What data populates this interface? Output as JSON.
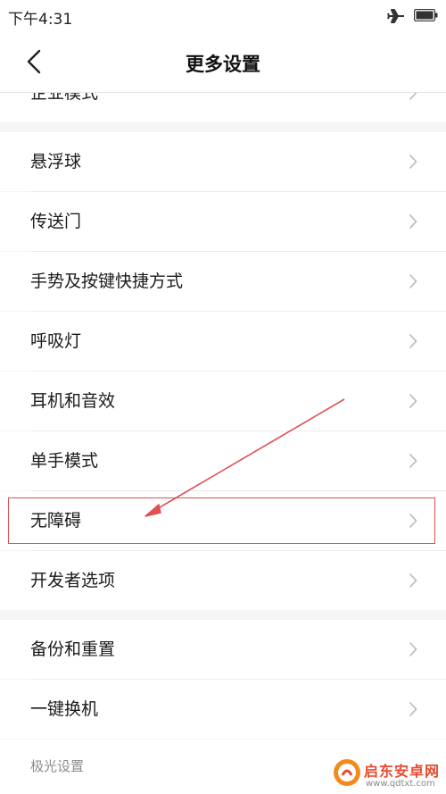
{
  "status_bar": {
    "time": "下午4:31",
    "airplane_mode_icon": "airplane-icon",
    "battery_icon": "battery-icon"
  },
  "header": {
    "title": "更多设置",
    "back_icon": "chevron-left-icon"
  },
  "partial_item": {
    "label": "企业模式"
  },
  "groups": [
    {
      "items": [
        {
          "label": "悬浮球"
        },
        {
          "label": "传送门"
        },
        {
          "label": "手势及按键快捷方式"
        },
        {
          "label": "呼吸灯"
        },
        {
          "label": "耳机和音效"
        },
        {
          "label": "单手模式"
        },
        {
          "label": "无障碍",
          "highlighted": true
        },
        {
          "label": "开发者选项"
        }
      ]
    },
    {
      "items": [
        {
          "label": "备份和重置"
        },
        {
          "label": "一键换机"
        }
      ]
    }
  ],
  "section_header": {
    "label": "极光设置"
  },
  "colors": {
    "accent_annotation": "#e05050",
    "background": "#f5f5f5",
    "row_background": "#ffffff",
    "chevron": "#b8b8b8"
  },
  "watermark": {
    "title": "启东安卓网",
    "url": "www.qdtxt.com"
  }
}
